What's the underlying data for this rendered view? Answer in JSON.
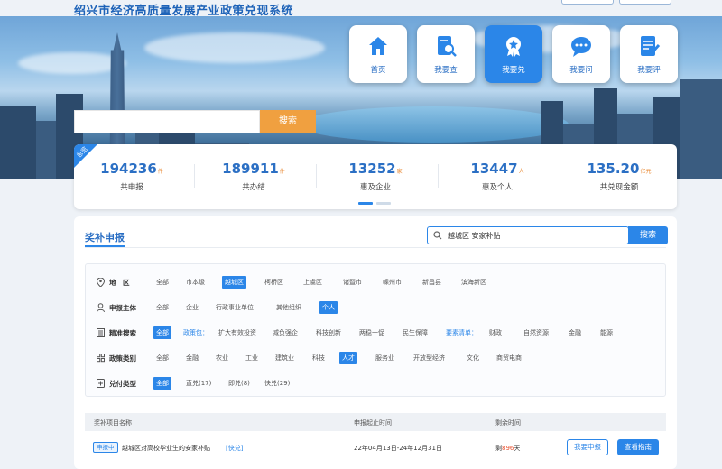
{
  "app": {
    "title": "绍兴市经济高质量发展产业政策兑现系统"
  },
  "nav": [
    {
      "label": "首页",
      "icon": "home-icon",
      "active": false
    },
    {
      "label": "我要查",
      "icon": "document-search-icon",
      "active": false
    },
    {
      "label": "我要兑",
      "icon": "award-icon",
      "active": true
    },
    {
      "label": "我要问",
      "icon": "chat-icon",
      "active": false
    },
    {
      "label": "我要评",
      "icon": "edit-document-icon",
      "active": false
    }
  ],
  "hero_search": {
    "placeholder": "",
    "button": "搜索"
  },
  "stats": {
    "badge": "总览",
    "items": [
      {
        "value": "194236",
        "unit": "件",
        "caption": "共申报"
      },
      {
        "value": "189911",
        "unit": "件",
        "caption": "共办结"
      },
      {
        "value": "13252",
        "unit": "家",
        "caption": "惠及企业"
      },
      {
        "value": "13447",
        "unit": "人",
        "caption": "惠及个人"
      },
      {
        "value": "135.20",
        "unit": "亿元",
        "caption": "共兑现金额"
      }
    ]
  },
  "panel": {
    "title": "奖补申报",
    "search_value": "越城区 安家补贴",
    "search_button": "搜索"
  },
  "filters": [
    {
      "label": "地　区",
      "options": [
        "全部",
        "市本级",
        "越城区",
        "柯桥区",
        "上虞区",
        "诸暨市",
        "嵊州市",
        "新昌县",
        "滨海新区"
      ],
      "selected": "越城区"
    },
    {
      "label": "申报主体",
      "options": [
        "全部",
        "企业",
        "行政事业单位",
        "其他组织",
        "个人"
      ],
      "selected": "个人"
    },
    {
      "label": "精准搜索",
      "options": [
        "全部",
        "政策包：",
        "扩大有效投资",
        "减负强企",
        "科技创新",
        "两稳一促",
        "民生保障",
        "要素清单：",
        "财政",
        "自然资源",
        "金融",
        "能源"
      ],
      "selected": "全部"
    },
    {
      "label": "政策类别",
      "options": [
        "全部",
        "金融",
        "农业",
        "工业",
        "建筑业",
        "科技",
        "人才",
        "服务业",
        "开放型经济",
        "文化",
        "商贸电商"
      ],
      "selected": "人才"
    },
    {
      "label": "兑付类型",
      "options": [
        "全部",
        "直兑(17)",
        "即兑(8)",
        "快兑(29)"
      ],
      "selected": "全部"
    }
  ],
  "table": {
    "headers": [
      "奖补项目名称",
      "申报起止时间",
      "剩余时间"
    ],
    "rows": [
      {
        "tag": "申报中",
        "name": "越城区对高校毕业生的安家补贴",
        "type": "[快兑]",
        "period": "22年04月13日-24年12月31日",
        "remain_prefix": "剩",
        "remain_days": "896",
        "remain_suffix": "天",
        "apply": "我要申报",
        "guide": "查看指南"
      }
    ]
  },
  "colors": {
    "primary": "#2b86e8",
    "accent": "#f0a040",
    "remain": "#e8502e"
  }
}
